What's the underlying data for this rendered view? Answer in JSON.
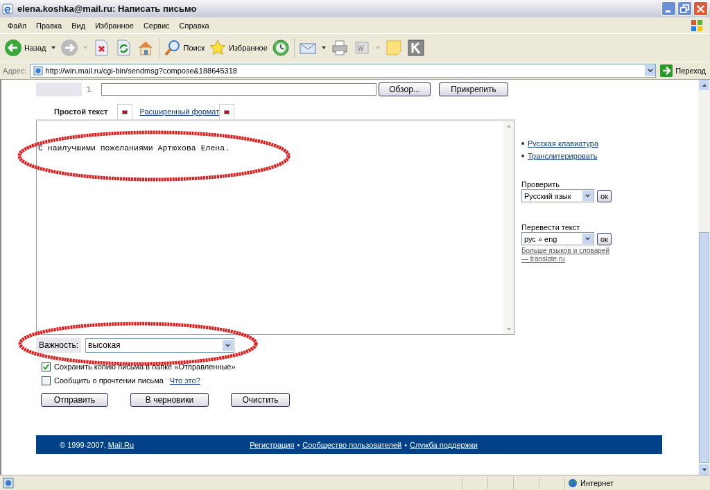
{
  "window": {
    "title": "elena.koshka@mail.ru: Написать письмо"
  },
  "menu": [
    "Файл",
    "Правка",
    "Вид",
    "Избранное",
    "Сервис",
    "Справка"
  ],
  "toolbar": {
    "back": "Назад",
    "search": "Поиск",
    "favorites": "Избранное"
  },
  "address": {
    "label": "Адрес:",
    "url": "http://win.mail.ru/cgi-bin/sendmsg?compose&188645318",
    "go": "Переход"
  },
  "attachment": {
    "number": "1.",
    "browse": "Обзор...",
    "attach": "Прикрепить"
  },
  "format_tabs": [
    {
      "label": "Простой текст",
      "selected": true
    },
    {
      "label": "Расширенный формат",
      "selected": false
    }
  ],
  "message": {
    "body": "С наилучшими пожеланиями Артюхова Елена."
  },
  "side_links": [
    "Русская клавиатура",
    "Транслитерировать"
  ],
  "spellcheck": {
    "label": "Проверить",
    "value": "Русский язык",
    "button": "ок"
  },
  "translate": {
    "label": "Перевести текст",
    "value": "рус » eng",
    "button": "ок",
    "more_link": "Больше языков и словарей — translate.ru"
  },
  "importance": {
    "label": "Важность:",
    "value": "высокая"
  },
  "options": [
    {
      "label": "Сохранить копию письма в папке «Отправленные»",
      "checked": true
    },
    {
      "label": "Сообщить о прочтении письма",
      "checked": false,
      "help_link": "Что это?"
    }
  ],
  "actions": [
    "Отправить",
    "В черновики",
    "Очистить"
  ],
  "footer": {
    "copyright": "© 1999-2007,",
    "brand_link": "Mail.Ru",
    "items": [
      {
        "kind": "link",
        "text": "Регистрация"
      },
      {
        "kind": "separator",
        "text": "•"
      },
      {
        "kind": "link",
        "text": "Сообщество пользователей"
      },
      {
        "kind": "separator",
        "text": "•"
      },
      {
        "kind": "link",
        "text": "Служба поддержки"
      }
    ]
  },
  "status_bar": {
    "zone": "Интернет"
  }
}
